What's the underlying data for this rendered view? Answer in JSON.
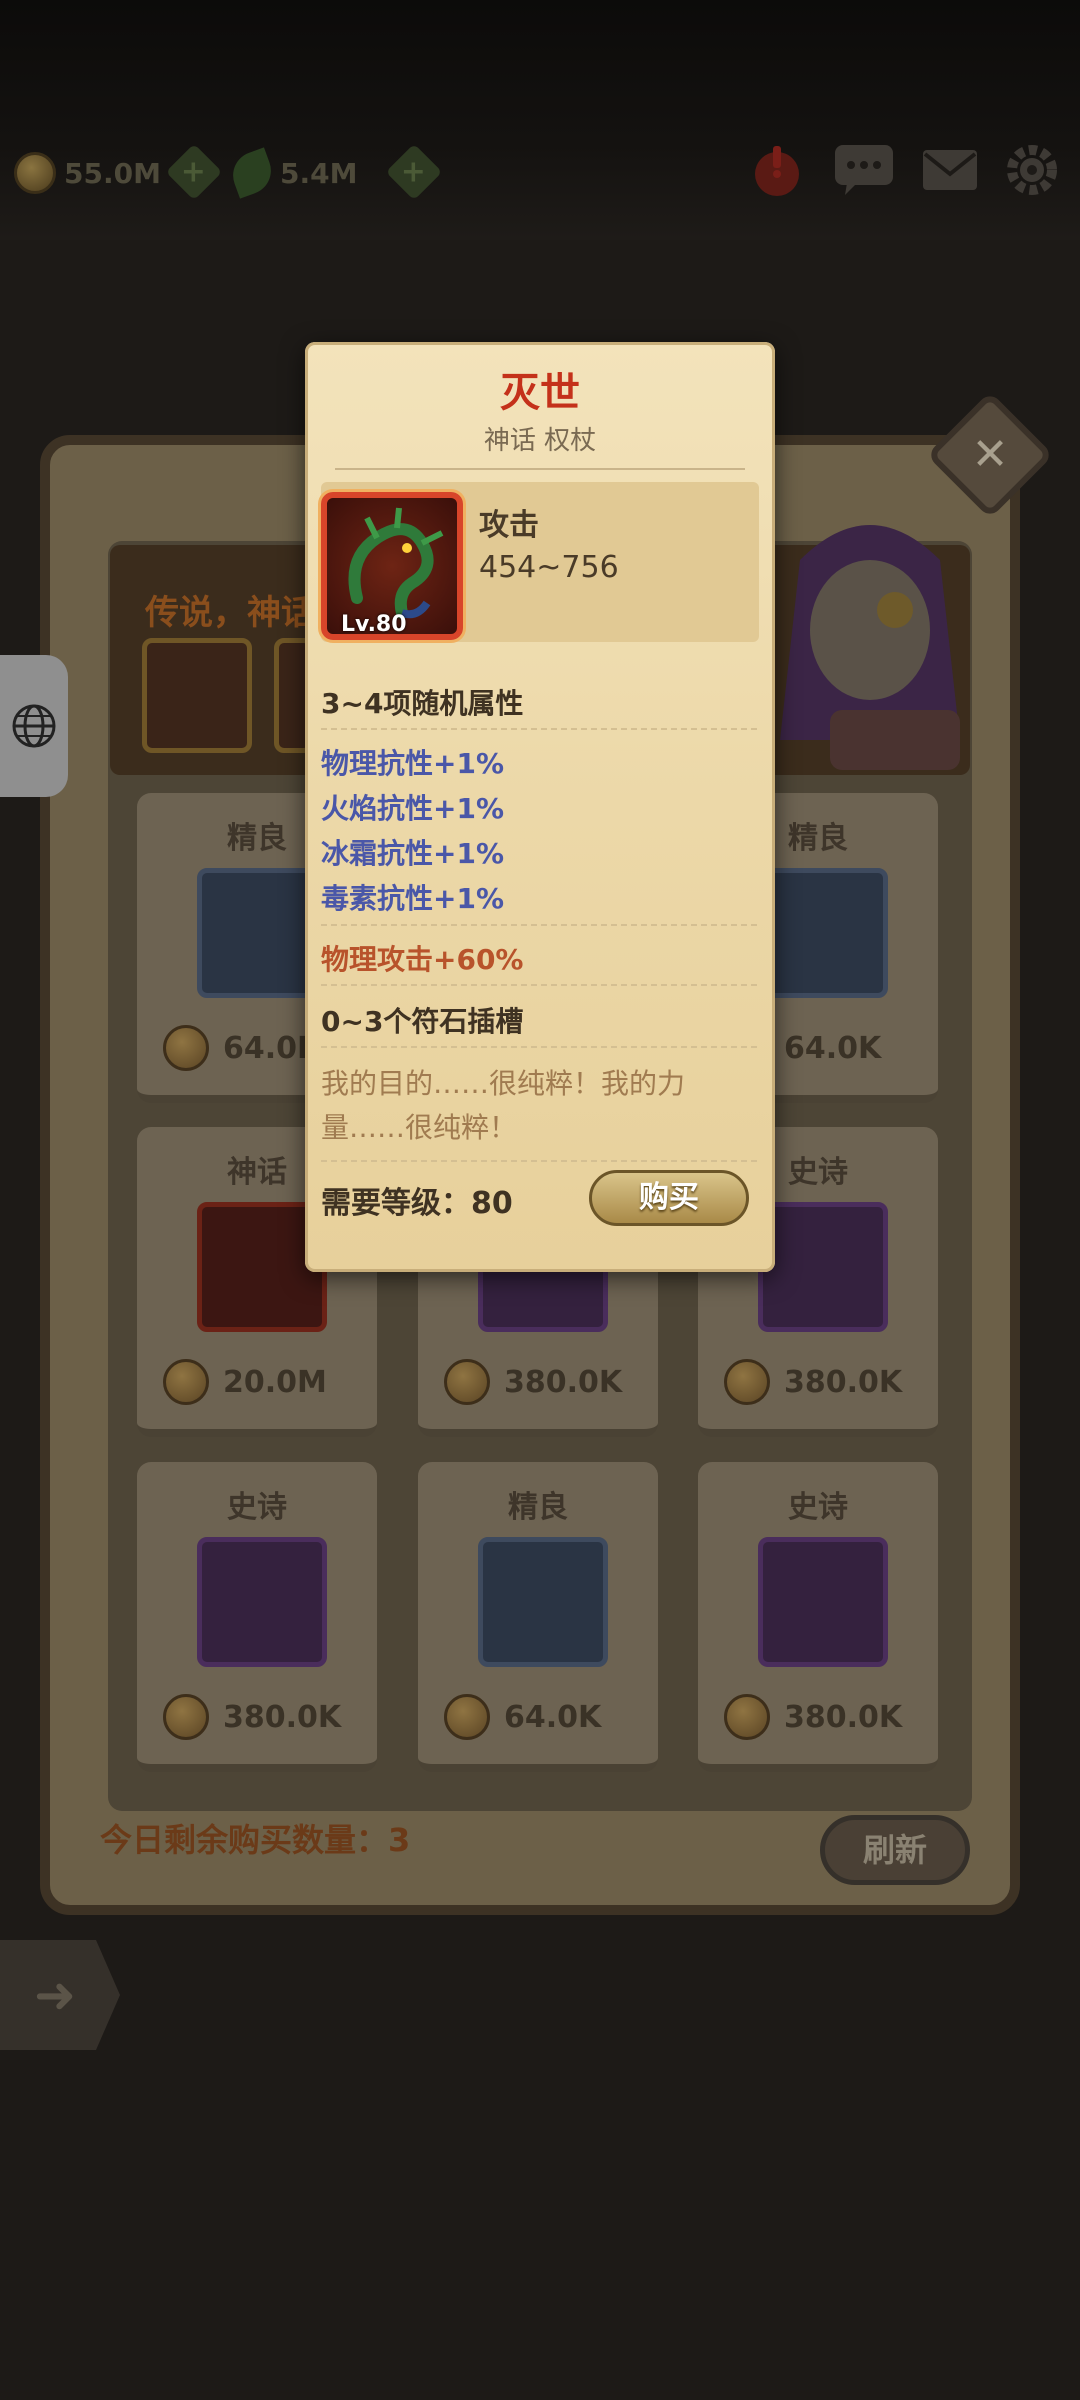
{
  "topbar": {
    "gold": "55.0M",
    "gems": "5.4M"
  },
  "shop": {
    "banner_text": "传说，神话",
    "remain_text": "今日剩余购买数量：3",
    "refresh_label": "刷新",
    "close_symbol": "✕",
    "cards": [
      {
        "quality": "精良",
        "price": "64.0K"
      },
      {
        "quality": "精良",
        "price": "64.0K"
      },
      {
        "quality": "神话",
        "price": "20.0M"
      },
      {
        "quality": "",
        "price": "380.0K"
      },
      {
        "quality": "史诗",
        "price": "380.0K"
      },
      {
        "quality": "史诗",
        "price": "380.0K"
      },
      {
        "quality": "精良",
        "price": "64.0K"
      },
      {
        "quality": "史诗",
        "price": "380.0K"
      }
    ]
  },
  "tooltip": {
    "name": "灭世",
    "subtitle": "神话 权杖",
    "level_badge": "Lv.80",
    "stat_label": "攻击",
    "stat_value": "454~756",
    "random_attrs": "3~4项随机属性",
    "resist": [
      "物理抗性+1%",
      "火焰抗性+1%",
      "冰霜抗性+1%",
      "毒素抗性+1%"
    ],
    "bonus": "物理攻击+60%",
    "sockets": "0~3个符石插槽",
    "description": "我的目的……很纯粹！我的力量……很纯粹！",
    "required_level": "需要等级：80",
    "buy_label": "购买"
  },
  "colors": {
    "title_red": "#c4311a",
    "resist_blue": "#4a57a8",
    "bonus_orange": "#b8532b"
  }
}
